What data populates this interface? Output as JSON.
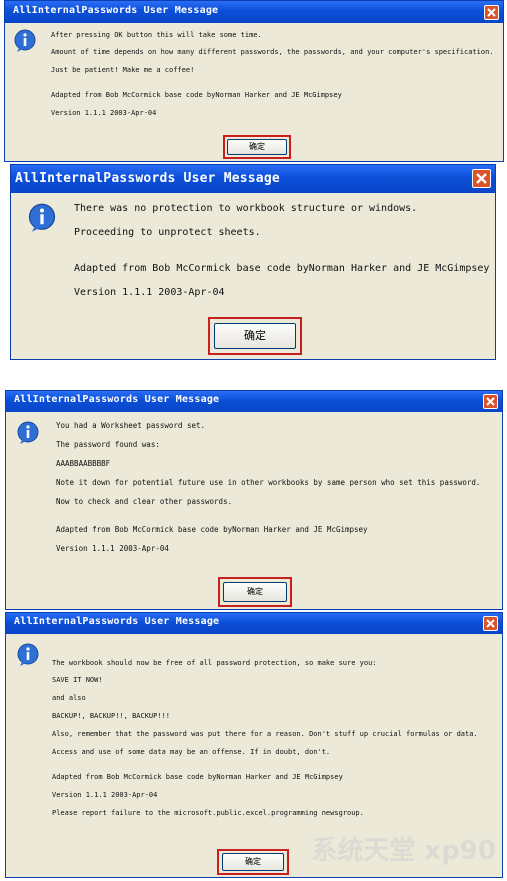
{
  "dialogs": [
    {
      "title": "AllInternalPasswords User Message",
      "ok_label": "确定",
      "lines": [
        "After pressing OK button this will take some time.",
        "Amount of time depends on how many different passwords, the passwords, and your computer's specification.",
        "Just be patient! Make me a coffee!",
        "Adapted from Bob McCormick base code byNorman Harker and JE McGimpsey",
        "Version 1.1.1 2003-Apr-04"
      ]
    },
    {
      "title": "AllInternalPasswords User Message",
      "ok_label": "确定",
      "lines": [
        "There was no protection to workbook structure or windows.",
        "Proceeding to unprotect sheets.",
        "Adapted from Bob McCormick base code byNorman Harker and JE McGimpsey",
        "Version 1.1.1 2003-Apr-04"
      ]
    },
    {
      "title": "AllInternalPasswords User Message",
      "ok_label": "确定",
      "lines": [
        "You had a Worksheet password set.",
        "The password found was:",
        "AAABBAABBBBF",
        "Note it down for potential future use in other workbooks by same person who set this password.",
        "Now to check and clear other passwords.",
        "Adapted from Bob McCormick base code byNorman Harker and JE McGimpsey",
        "Version 1.1.1 2003-Apr-04"
      ]
    },
    {
      "title": "AllInternalPasswords User Message",
      "ok_label": "确定",
      "lines": [
        "The workbook should now be free of all password protection, so make sure you:",
        "SAVE IT NOW!",
        "and also",
        "BACKUP!, BACKUP!!, BACKUP!!!",
        "Also, remember that the password was put there for a reason. Don't stuff up crucial formulas or data.",
        "Access and use of some data may be an offense. If in doubt, don't.",
        "Adapted from Bob McCormick base code byNorman Harker and JE McGimpsey",
        "Version 1.1.1 2003-Apr-04",
        "Please report failure to the microsoft.public.excel.programming newsgroup."
      ]
    }
  ],
  "icons": {
    "info": "info-icon",
    "close": "close-icon"
  },
  "colors": {
    "titlebar": "#0b4fd8",
    "dialog_bg": "#ece9d8",
    "highlight": "#c8201e",
    "close": "#d9532b"
  },
  "watermark": "系统天堂 xp90"
}
